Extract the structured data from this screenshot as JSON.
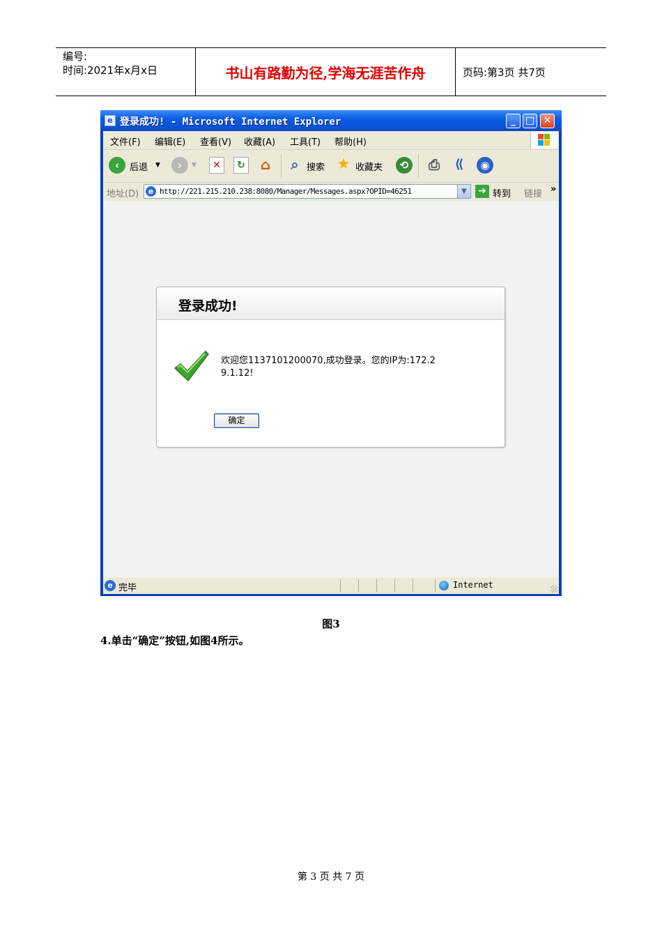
{
  "header": {
    "number_label": "编号:",
    "time_label": "时间:2021年x月x日",
    "motto": "书山有路勤为径,学海无涯苦作舟",
    "page_info": "页码:第3页  共7页"
  },
  "browser": {
    "title": "登录成功! - Microsoft Internet Explorer",
    "menu": [
      "文件(F)",
      "编辑(E)",
      "查看(V)",
      "收藏(A)",
      "工具(T)",
      "帮助(H)"
    ],
    "toolbar": {
      "back": "后退",
      "search": "搜索",
      "favorites": "收藏夹"
    },
    "address_label": "地址(D)",
    "url": "http://221.215.210.238:8080/Manager/Messages.aspx?OPID=46251",
    "go_label": "转到",
    "links_label": "链接",
    "status_text": "完毕",
    "zone": "Internet"
  },
  "dialog": {
    "title": "登录成功!",
    "message_line1": "欢迎您1137101200070,成功登录。您的IP为:172.2",
    "message_line2": "9.1.12!",
    "ok_button": "确定"
  },
  "caption": "图3",
  "step_text": "4.单击“确定”按钮,如图4所示。",
  "footer": "第 3 页 共 7 页",
  "colors": {
    "motto": "#e00000",
    "titlebar": "#0b5ce6",
    "check": "#3aa52a"
  }
}
